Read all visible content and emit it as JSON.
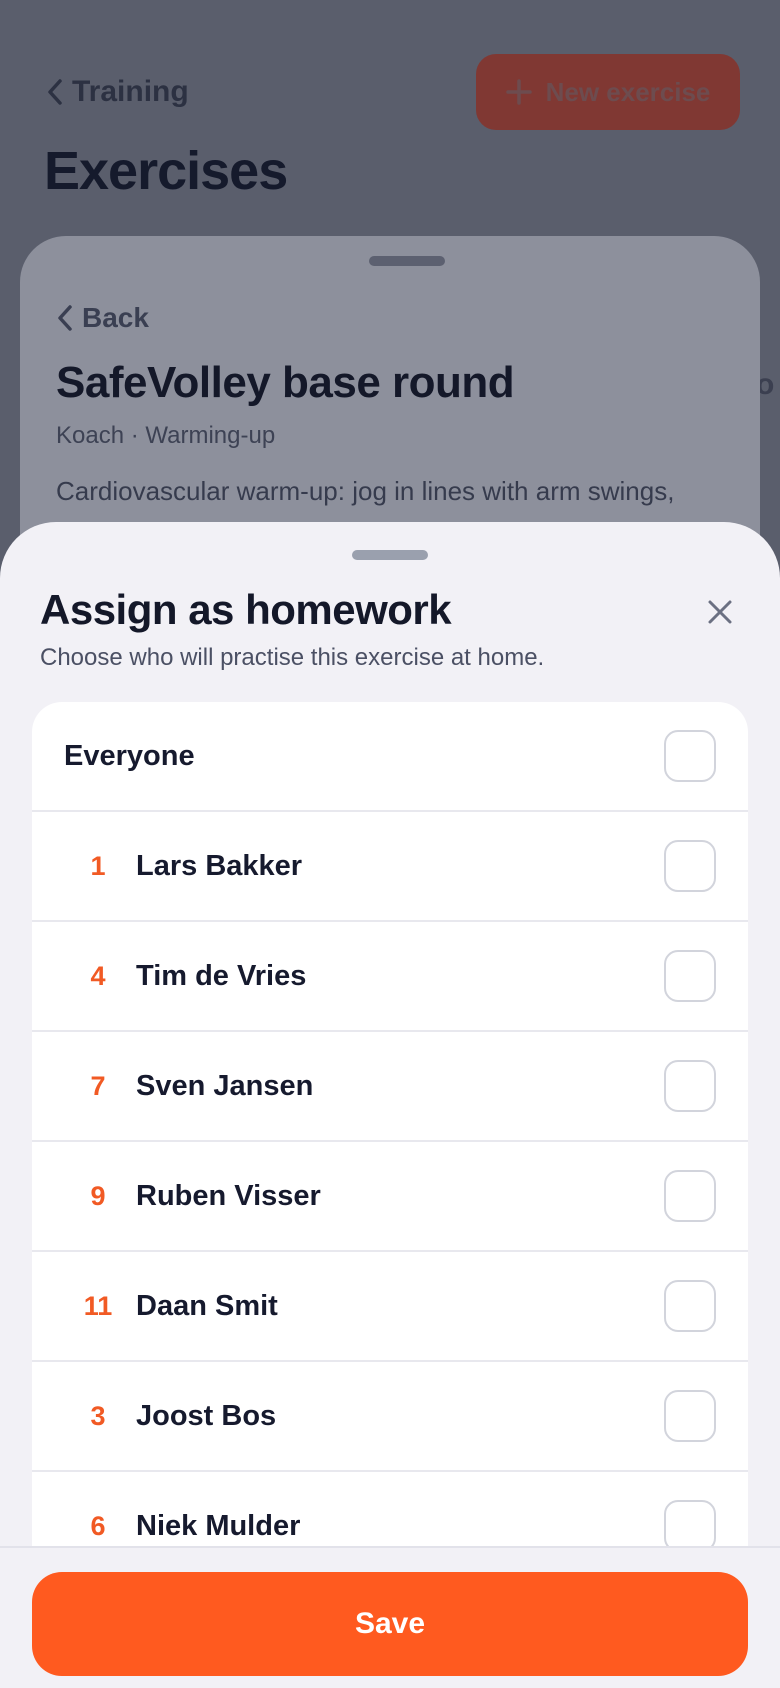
{
  "background": {
    "back_label": "Training",
    "new_button_label": "New exercise",
    "page_title": "Exercises",
    "edge_text": "o"
  },
  "exercise_sheet": {
    "back_label": "Back",
    "title": "SafeVolley base round",
    "subtitle": "Koach · Warming-up",
    "description": "Cardiovascular warm-up: jog in lines with arm swings,"
  },
  "homework_sheet": {
    "title": "Assign as homework",
    "subtitle": "Choose who will practise this exercise at home.",
    "everyone_label": "Everyone",
    "players": [
      {
        "number": "1",
        "name": "Lars Bakker"
      },
      {
        "number": "4",
        "name": "Tim de Vries"
      },
      {
        "number": "7",
        "name": "Sven Jansen"
      },
      {
        "number": "9",
        "name": "Ruben Visser"
      },
      {
        "number": "11",
        "name": "Daan Smit"
      },
      {
        "number": "3",
        "name": "Joost Bos"
      },
      {
        "number": "6",
        "name": "Niek Mulder"
      }
    ],
    "save_label": "Save"
  },
  "colors": {
    "accent": "#ff5a1f",
    "number": "#f15a24"
  }
}
